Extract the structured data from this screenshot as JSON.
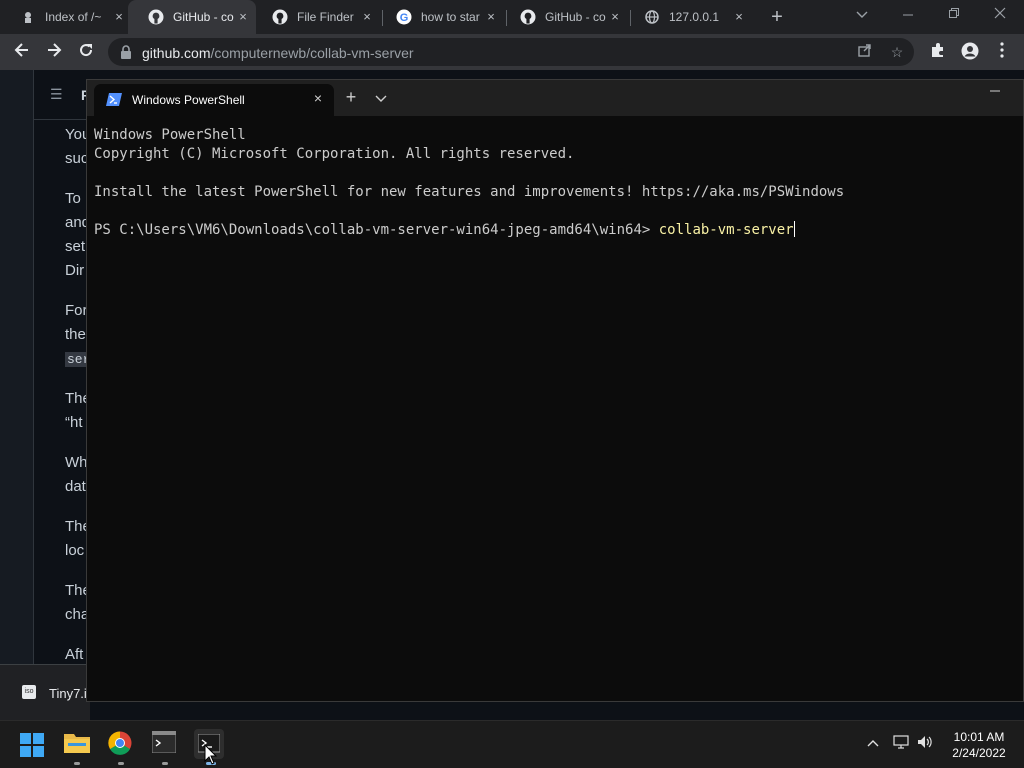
{
  "browser": {
    "tabs": [
      {
        "label": "Index of /~",
        "icon": "index-icon",
        "active": false
      },
      {
        "label": "GitHub - co",
        "icon": "github-icon",
        "active": true
      },
      {
        "label": "File Finder",
        "icon": "github-icon",
        "active": false
      },
      {
        "label": "how to star",
        "icon": "google-icon",
        "active": false
      },
      {
        "label": "GitHub - co",
        "icon": "github-icon",
        "active": false
      },
      {
        "label": "127.0.0.1",
        "icon": "globe-icon",
        "active": false
      }
    ],
    "tab_close": "×",
    "new_tab": "+",
    "address": {
      "host": "github.com",
      "path": "/computernewb/collab-vm-server"
    }
  },
  "github_page": {
    "toc_letter": "R",
    "lines": [
      "You",
      "suc",
      "To",
      "and",
      "set",
      "Dir",
      "For",
      "the",
      "ser",
      "The",
      "“ht",
      "Wh",
      "dat",
      "The",
      "loc",
      "The",
      "cha",
      "Aft"
    ],
    "notification": "Tiny7.i"
  },
  "terminal": {
    "tab_title": "Windows PowerShell",
    "lines": [
      "Windows PowerShell",
      "Copyright (C) Microsoft Corporation. All rights reserved.",
      "",
      "Install the latest PowerShell for new features and improvements! https://aka.ms/PSWindows",
      ""
    ],
    "prompt": "PS C:\\Users\\VM6\\Downloads\\collab-vm-server-win64-jpeg-amd64\\win64> ",
    "command": "collab-vm-server"
  },
  "taskbar": {
    "time": "10:01 AM",
    "date": "2/24/2022"
  },
  "colors": {
    "terminal_bg": "#0c0c0c",
    "command_text": "#f9f1a5",
    "chrome_tabstrip": "#202124",
    "taskbar_bg": "#1c1c1c"
  }
}
